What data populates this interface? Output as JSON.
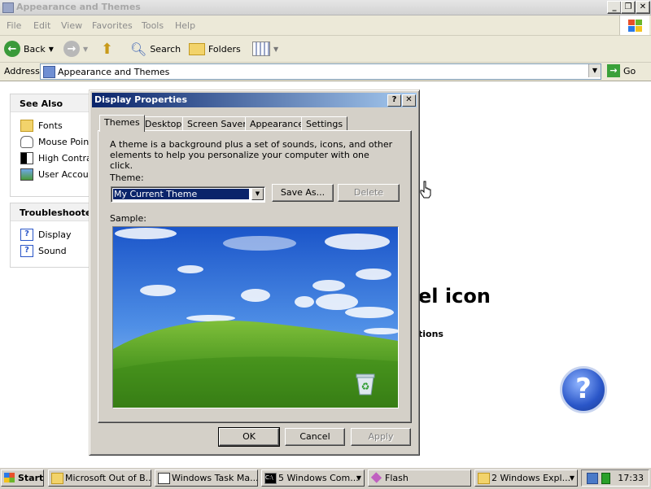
{
  "window": {
    "title": "Appearance and Themes",
    "caption_buttons": [
      "_",
      "❐",
      "✕"
    ]
  },
  "menu": [
    "File",
    "Edit",
    "View",
    "Favorites",
    "Tools",
    "Help"
  ],
  "toolbar": {
    "back_label": "Back",
    "search_label": "Search",
    "folders_label": "Folders"
  },
  "address": {
    "label": "Address",
    "value": "Appearance and Themes",
    "go_label": "Go"
  },
  "see_also": {
    "title": "See Also",
    "items": [
      "Fonts",
      "Mouse Pointers",
      "High Contrast",
      "User Account Picture"
    ]
  },
  "troubleshooters": {
    "title": "Troubleshooters",
    "items": [
      "Display",
      "Sound"
    ]
  },
  "background_text": {
    "heading_fragment": "el icon",
    "sub_fragment": "tions"
  },
  "dialog": {
    "title": "Display Properties",
    "help_button": "?",
    "close_button": "✕",
    "tabs": [
      "Themes",
      "Desktop",
      "Screen Saver",
      "Appearance",
      "Settings"
    ],
    "active_tab": "Themes",
    "description": "A theme is a background plus a set of sounds, icons, and other elements to help you personalize your computer with one click.",
    "theme_label": "Theme:",
    "theme_value": "My Current Theme",
    "save_as_label": "Save As...",
    "delete_label": "Delete",
    "sample_label": "Sample:",
    "ok_label": "OK",
    "cancel_label": "Cancel",
    "apply_label": "Apply"
  },
  "taskbar": {
    "start_label": "Start",
    "tasks": [
      "Microsoft Out of B...",
      "Windows Task Ma...",
      "5 Windows Com...",
      "Flash",
      "2 Windows Expl..."
    ],
    "clock": "17:33"
  },
  "colors": {
    "dialog_title_start": "#0a246a",
    "dialog_title_end": "#a6caf0",
    "selection": "#0a246a",
    "face": "#d4d0c8"
  }
}
